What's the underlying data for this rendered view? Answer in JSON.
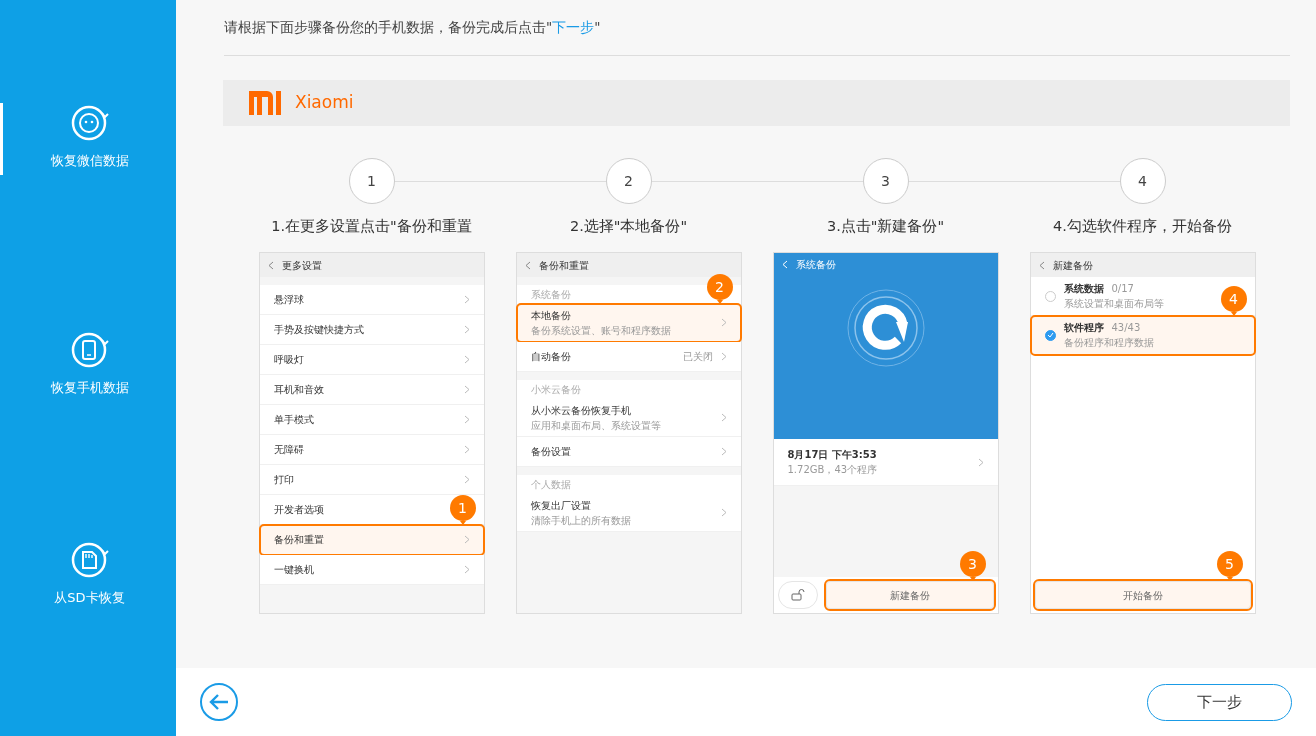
{
  "sidebar": {
    "items": [
      {
        "kind": "wechat",
        "label": "恢复微信数据",
        "selected": true
      },
      {
        "kind": "phone",
        "label": "恢复手机数据",
        "selected": false
      },
      {
        "kind": "sd",
        "label": "从SD卡恢复",
        "selected": false
      }
    ]
  },
  "instruction": {
    "text": "请根据下面步骤备份您的手机数据，备份完成后点击\"",
    "link": "下一步",
    "suffix": "\""
  },
  "brand": {
    "name": "Xiaomi"
  },
  "steps": [
    {
      "number": "1",
      "title": "1.在更多设置点击\"备份和重置"
    },
    {
      "number": "2",
      "title": "2.选择\"本地备份\""
    },
    {
      "number": "3",
      "title": "3.点击\"新建备份\""
    },
    {
      "number": "4",
      "title": "4.勾选软件程序，开始备份"
    }
  ],
  "phones": [
    {
      "kind": "settings",
      "title": "更多设置",
      "sections": [
        {
          "items": [
            {
              "label": "悬浮球",
              "highlighted": false
            },
            {
              "label": "手势及按键快捷方式",
              "highlighted": false
            },
            {
              "label": "呼吸灯",
              "highlighted": false
            },
            {
              "label": "耳机和音效",
              "highlighted": false
            },
            {
              "label": "单手模式",
              "highlighted": false
            },
            {
              "label": "无障碍",
              "highlighted": false
            },
            {
              "label": "打印",
              "highlighted": false
            },
            {
              "label": "开发者选项",
              "highlighted": false
            },
            {
              "label": "备份和重置",
              "highlighted": true,
              "callout": "1"
            },
            {
              "label": "一键换机",
              "highlighted": false
            }
          ]
        }
      ]
    },
    {
      "kind": "settings",
      "title": "备份和重置",
      "sections": [
        {
          "header": "系统备份",
          "items": [
            {
              "label": "本地备份",
              "sub": "备份系统设置、账号和程序数据",
              "highlighted": true,
              "callout": "2"
            },
            {
              "label": "自动备份",
              "value": "已关闭",
              "highlighted": false
            }
          ]
        },
        {
          "header": "小米云备份",
          "items": [
            {
              "label": "从小米云备份恢复手机",
              "sub": "应用和桌面布局、系统设置等",
              "highlighted": false
            },
            {
              "label": "备份设置",
              "highlighted": false
            }
          ]
        },
        {
          "header": "个人数据",
          "items": [
            {
              "label": "恢复出厂设置",
              "sub": "清除手机上的所有数据",
              "highlighted": false
            }
          ]
        }
      ]
    },
    {
      "kind": "backup",
      "title": "系统备份",
      "entry": {
        "label": "8月17日 下午3:53",
        "sub": "1.72GB，43个程序"
      },
      "button": {
        "label": "新建备份",
        "highlighted": true,
        "callout": "3"
      }
    },
    {
      "kind": "select",
      "title": "新建备份",
      "options": [
        {
          "label": "系统数据",
          "count": "0/17",
          "sub": "系统设置和桌面布局等",
          "checked": false,
          "highlighted": false
        },
        {
          "label": "软件程序",
          "count": "43/43",
          "sub": "备份程序和程序数据",
          "checked": true,
          "highlighted": true,
          "callout": "4"
        }
      ],
      "button": {
        "label": "开始备份",
        "highlighted": true,
        "callout": "5"
      }
    }
  ],
  "footer": {
    "next": "下一步"
  }
}
